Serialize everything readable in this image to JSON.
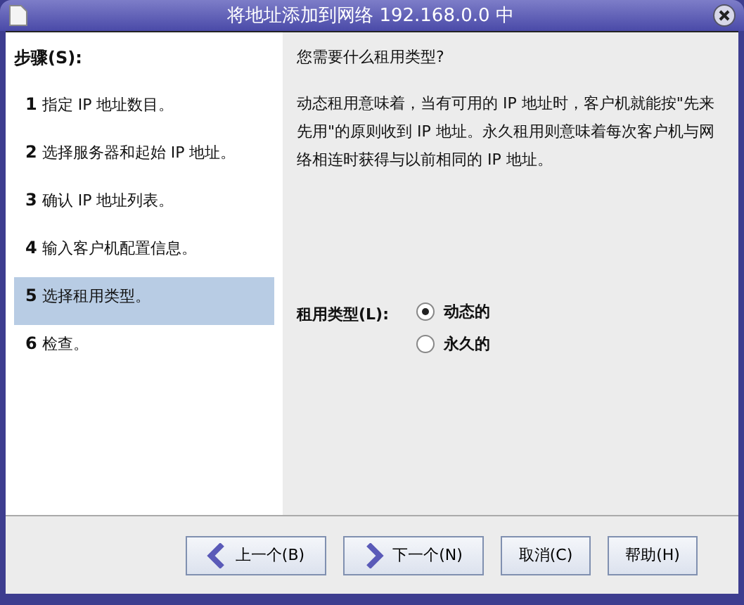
{
  "window": {
    "title": "将地址添加到网络 192.168.0.0 中"
  },
  "steps": {
    "heading": "步骤(S):",
    "items": [
      {
        "number": "1",
        "label": "指定 IP 地址数目。",
        "selected": false
      },
      {
        "number": "2",
        "label": "选择服务器和起始 IP 地址。",
        "selected": false
      },
      {
        "number": "3",
        "label": "确认 IP 地址列表。",
        "selected": false
      },
      {
        "number": "4",
        "label": "输入客户机配置信息。",
        "selected": false
      },
      {
        "number": "5",
        "label": "选择租用类型。",
        "selected": true
      },
      {
        "number": "6",
        "label": "检查。",
        "selected": false
      }
    ]
  },
  "content": {
    "question": "您需要什么租用类型?",
    "description": "动态租用意味着，当有可用的 IP 地址时，客户机就能按\"先来先用\"的原则收到 IP 地址。永久租用则意味着每次客户机与网络相连时获得与以前相同的 IP 地址。",
    "lease_label": "租用类型(L):",
    "options": [
      {
        "label": "动态的",
        "selected": true
      },
      {
        "label": "永久的",
        "selected": false
      }
    ]
  },
  "buttons": [
    {
      "label": "上一个(B)",
      "kind": "back"
    },
    {
      "label": "下一个(N)",
      "kind": "next"
    },
    {
      "label": "取消(C)",
      "kind": "plain"
    },
    {
      "label": "帮助(H)",
      "kind": "plain"
    }
  ]
}
